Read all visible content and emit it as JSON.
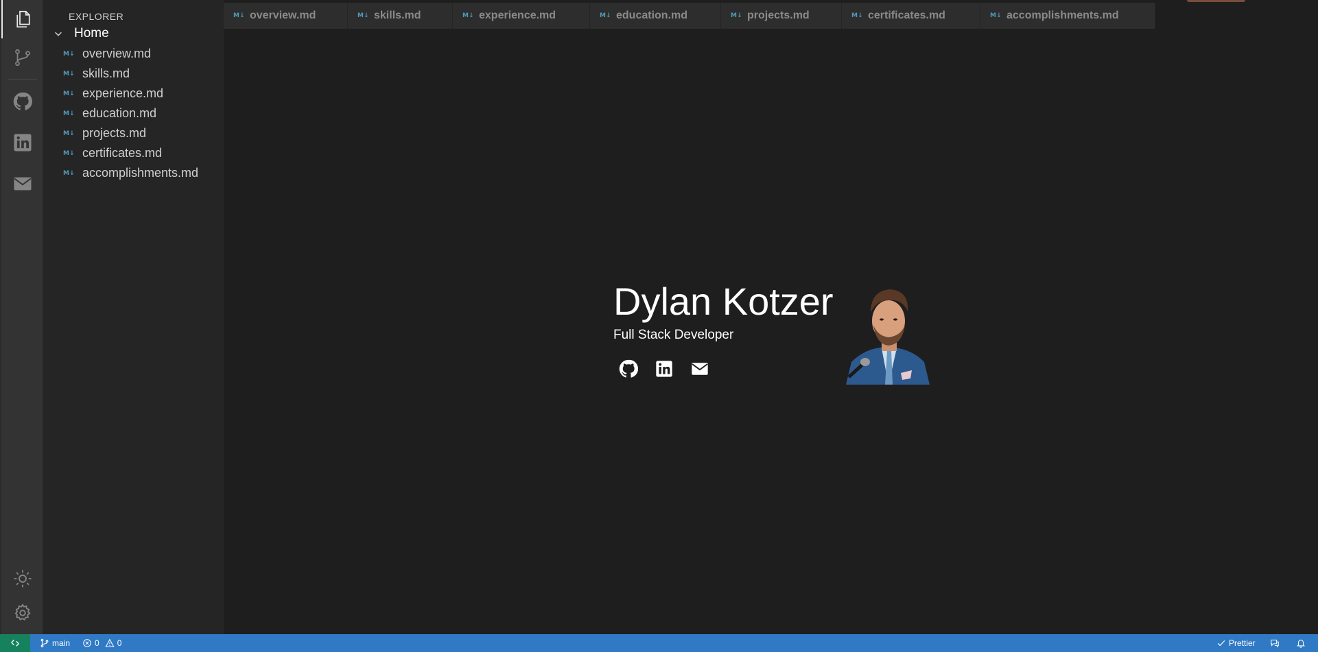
{
  "colors": {
    "activity_bar": "#333333",
    "sidebar": "#252526",
    "editor": "#1e1e1e",
    "tab": "#2d2d2d",
    "statusbar": "#3079c5",
    "remote": "#16825d",
    "md_icon": "#519aba"
  },
  "activity_bar": {
    "items": [
      {
        "icon": "files-icon",
        "active": true
      },
      {
        "icon": "source-control-icon"
      },
      {
        "icon": "github-icon"
      },
      {
        "icon": "linkedin-icon"
      },
      {
        "icon": "mail-icon"
      }
    ],
    "bottom": [
      {
        "icon": "theme-sun-icon"
      },
      {
        "icon": "gear-icon"
      }
    ]
  },
  "sidebar": {
    "title": "EXPLORER",
    "folder": "Home",
    "md_badge": "M↓",
    "files": [
      "overview.md",
      "skills.md",
      "experience.md",
      "education.md",
      "projects.md",
      "certificates.md",
      "accomplishments.md"
    ]
  },
  "tabs": [
    "overview.md",
    "skills.md",
    "experience.md",
    "education.md",
    "projects.md",
    "certificates.md",
    "accomplishments.md"
  ],
  "hero": {
    "name": "Dylan Kotzer",
    "role": "Full Stack Developer",
    "socials": [
      "github-icon",
      "linkedin-icon",
      "mail-icon"
    ]
  },
  "statusbar": {
    "branch": "main",
    "errors": "0",
    "warnings": "0",
    "prettier": "Prettier"
  }
}
